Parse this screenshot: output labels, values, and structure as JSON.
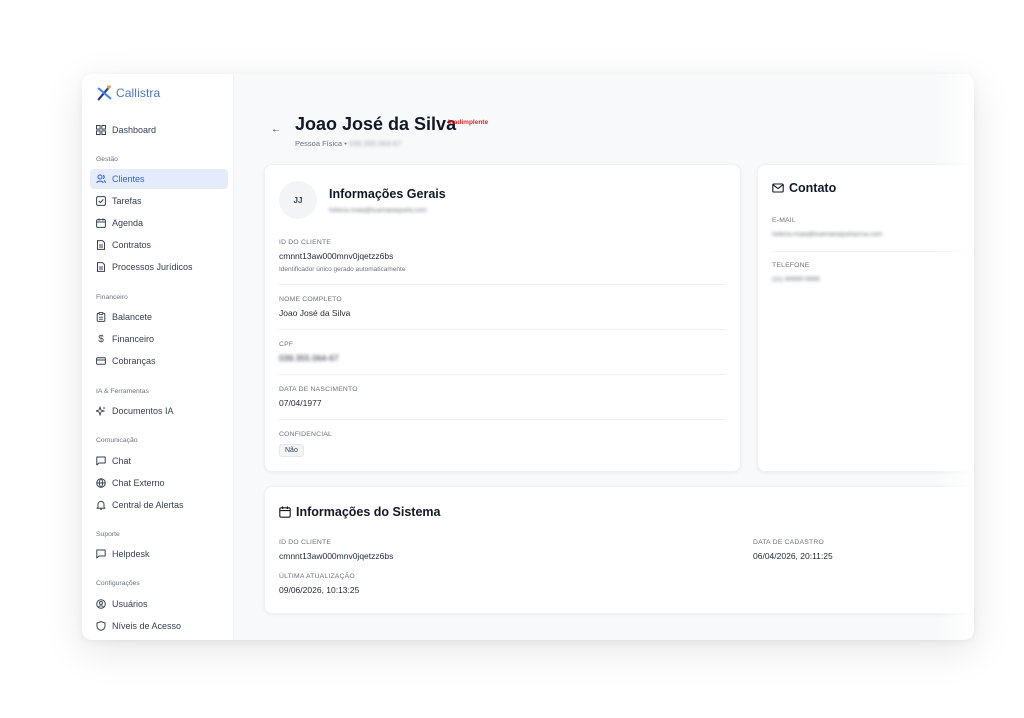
{
  "brand": {
    "name": "Callistra",
    "accent": "#4a74c9"
  },
  "sidebar": {
    "dashboard": {
      "label": "Dashboard",
      "icon": "dashboard-icon"
    },
    "sections": [
      {
        "label": "Gestão",
        "items": [
          {
            "label": "Clientes",
            "icon": "users-icon",
            "active": true
          },
          {
            "label": "Tarefas",
            "icon": "checkbox-icon"
          },
          {
            "label": "Agenda",
            "icon": "calendar-icon"
          },
          {
            "label": "Contratos",
            "icon": "document-icon"
          },
          {
            "label": "Processos Jurídicos",
            "icon": "document-icon"
          }
        ]
      },
      {
        "label": "Financeiro",
        "items": [
          {
            "label": "Balancete",
            "icon": "clipboard-icon"
          },
          {
            "label": "Financeiro",
            "icon": "dollar-icon"
          },
          {
            "label": "Cobranças",
            "icon": "credit-card-icon"
          }
        ]
      },
      {
        "label": "IA & Ferramentas",
        "items": [
          {
            "label": "Documentos IA",
            "icon": "sparkles-icon"
          }
        ]
      },
      {
        "label": "Comunicação",
        "items": [
          {
            "label": "Chat",
            "icon": "chat-icon"
          },
          {
            "label": "Chat Externo",
            "icon": "globe-icon"
          },
          {
            "label": "Central de Alertas",
            "icon": "bell-icon"
          }
        ]
      },
      {
        "label": "Suporte",
        "items": [
          {
            "label": "Helpdesk",
            "icon": "chat-icon"
          }
        ]
      },
      {
        "label": "Configurações",
        "items": [
          {
            "label": "Usuários",
            "icon": "user-circle-icon"
          },
          {
            "label": "Níveis de Acesso",
            "icon": "shield-icon"
          }
        ]
      }
    ]
  },
  "header": {
    "back_icon": "arrow-left-icon",
    "name": "Joao José da Silva",
    "status_badge": "Inadimplente",
    "status_color": "#dc2626",
    "type": "Pessoa Física",
    "separator": "•",
    "cpf_masked": "039.355.064-67"
  },
  "general": {
    "avatar_initials": "JJ",
    "title": "Informações Gerais",
    "email_masked": "helena-maia@tuamaeaquela.com",
    "fields": {
      "client_id": {
        "label": "ID DO CLIENTE",
        "value": "cmnnt13aw000mnv0jqetzz6bs",
        "hint": "Identificador único gerado automaticamente"
      },
      "full_name": {
        "label": "NOME COMPLETO",
        "value": "Joao José da Silva"
      },
      "cpf": {
        "label": "CPF",
        "value": "039.355.064-67"
      },
      "birth": {
        "label": "DATA DE NASCIMENTO",
        "value": "07/04/1977"
      },
      "confidential": {
        "label": "CONFIDENCIAL",
        "value": "Não"
      }
    }
  },
  "contact": {
    "title": "Contato",
    "icon": "mail-icon",
    "email": {
      "label": "E-MAIL",
      "value": "helena-maia@tuamaeaquelaursa.com"
    },
    "phone": {
      "label": "TELEFONE",
      "value": "(11) 99999-9999"
    }
  },
  "system": {
    "title": "Informações do Sistema",
    "icon": "calendar-icon",
    "client_id": {
      "label": "ID DO CLIENTE",
      "value": "cmnnt13aw000mnv0jqetzz6bs"
    },
    "created": {
      "label": "DATA DE CADASTRO",
      "value": "06/04/2026, 20:11:25"
    },
    "updated": {
      "label": "ÚLTIMA ATUALIZAÇÃO",
      "value": "09/06/2026, 10:13:25"
    }
  }
}
